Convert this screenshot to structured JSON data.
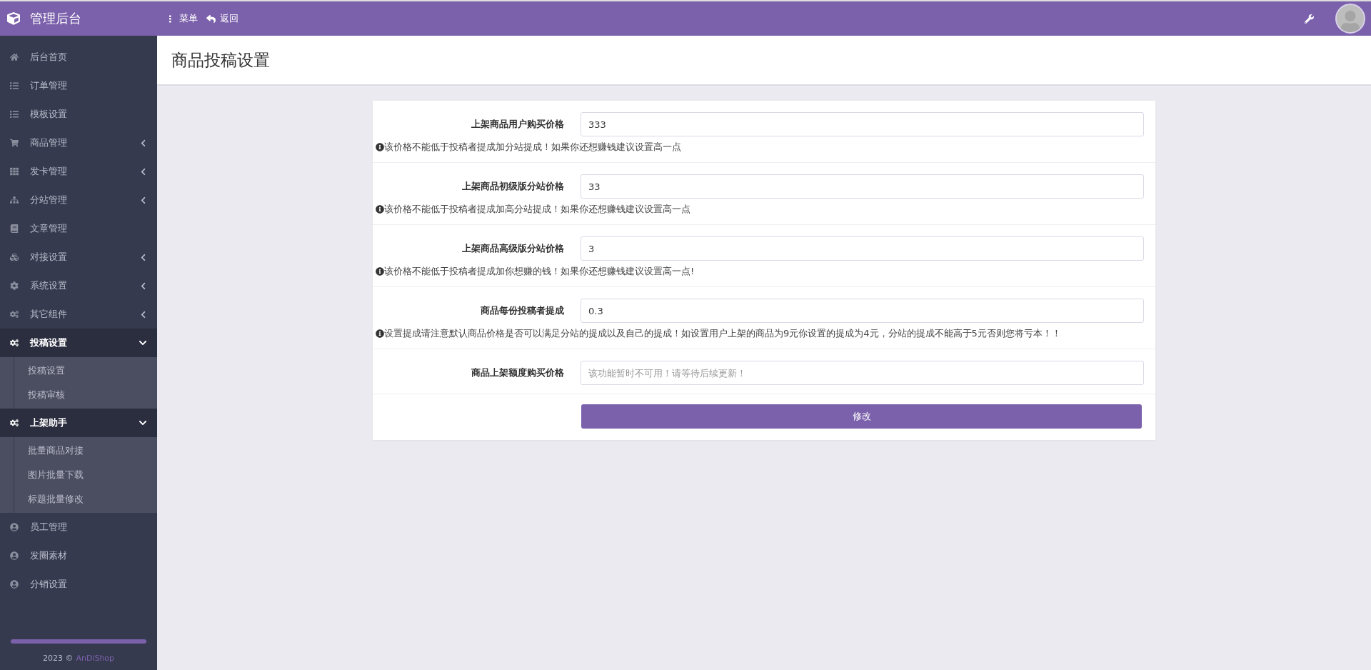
{
  "topbar": {
    "brand": "管理后台",
    "actions": [
      {
        "icon": "⋮",
        "label": "菜单"
      },
      {
        "label": "返回"
      }
    ]
  },
  "sidebar": {
    "items": [
      {
        "label": "后台首页",
        "kind": "link"
      },
      {
        "label": "订单管理",
        "kind": "link"
      },
      {
        "label": "模板设置",
        "kind": "link"
      },
      {
        "label": "商品管理",
        "kind": "group",
        "expanded": false
      },
      {
        "label": "发卡管理",
        "kind": "group",
        "expanded": false
      },
      {
        "label": "分站管理",
        "kind": "group",
        "expanded": false
      },
      {
        "label": "文章管理",
        "kind": "link"
      },
      {
        "label": "对接设置",
        "kind": "group",
        "expanded": false
      },
      {
        "label": "系统设置",
        "kind": "group",
        "expanded": false
      },
      {
        "label": "其它组件",
        "kind": "group",
        "expanded": false
      },
      {
        "label": "投稿设置",
        "kind": "group",
        "expanded": true,
        "children": [
          {
            "label": "投稿设置"
          },
          {
            "label": "投稿审核"
          }
        ]
      },
      {
        "label": "上架助手",
        "kind": "group",
        "expanded": true,
        "children": [
          {
            "label": "批量商品对接"
          },
          {
            "label": "图片批量下载"
          },
          {
            "label": "标题批量修改"
          }
        ]
      },
      {
        "label": "员工管理",
        "kind": "link"
      },
      {
        "label": "发圈素材",
        "kind": "link"
      },
      {
        "label": "分销设置",
        "kind": "link"
      }
    ],
    "footer": {
      "year": "2023 ©",
      "link": "AnDiShop"
    }
  },
  "page_title": "商品投稿设置",
  "form": {
    "fields": [
      {
        "label": "上架商品用户购买价格",
        "value": "333",
        "help": "该价格不能低于投稿者提成加分站提成！如果你还想赚钱建议设置高一点"
      },
      {
        "label": "上架商品初级版分站价格",
        "value": "33",
        "help": "该价格不能低于投稿者提成加高分站提成！如果你还想赚钱建议设置高一点"
      },
      {
        "label": "上架商品高级版分站价格",
        "value": "3",
        "help": "该价格不能低于投稿者提成加你想赚的钱！如果你还想赚钱建议设置高一点!"
      },
      {
        "label": "商品每份投稿者提成",
        "value": "0.3",
        "help": "设置提成请注意默认商品价格是否可以满足分站的提成以及自己的提成！如设置用户上架的商品为9元你设置的提成为4元，分站的提成不能高于5元否则您将亏本！！"
      },
      {
        "label": "商品上架额度购买价格",
        "placeholder": "该功能暂时不可用！请等待后续更新！"
      }
    ],
    "submit": "修改"
  }
}
